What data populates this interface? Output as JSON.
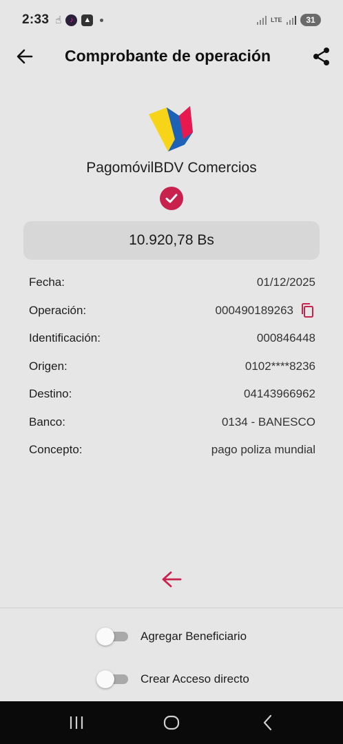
{
  "status_bar": {
    "time": "2:33",
    "network": "LTE",
    "battery": "31",
    "icons": [
      "hand-icon",
      "music-app-icon",
      "notification-icon",
      "dot-icon",
      "signal-icon",
      "lte-icon",
      "battery-icon"
    ]
  },
  "header": {
    "title": "Comprobante de operación",
    "back_icon": "arrow-left-icon",
    "share_icon": "share-icon"
  },
  "brand": {
    "name": "PagomóvilBDV Comercios",
    "logo_colors": [
      "#f7d418",
      "#e8194e",
      "#1e62b7"
    ]
  },
  "status": {
    "icon": "checkmark-circle-icon",
    "color": "#c8214e"
  },
  "amount": "10.920,78 Bs",
  "details": {
    "fecha": {
      "label": "Fecha:",
      "value": "01/12/2025"
    },
    "operacion": {
      "label": "Operación:",
      "value": "000490189263"
    },
    "identificacion": {
      "label": "Identificación:",
      "value": "000846448"
    },
    "origen": {
      "label": "Origen:",
      "value": "0102****8236"
    },
    "destino": {
      "label": "Destino:",
      "value": "04143966962"
    },
    "banco": {
      "label": "Banco:",
      "value": "0134 - BANESCO"
    },
    "concepto": {
      "label": "Concepto:",
      "value": "pago poliza mundial"
    }
  },
  "toggles": {
    "agregar": {
      "label": "Agregar Beneficiario",
      "on": false
    },
    "acceso": {
      "label": "Crear Acceso directo",
      "on": false
    }
  },
  "colors": {
    "accent": "#c8214e",
    "background": "#e6e6e6",
    "amount_box": "#d7d7d7"
  }
}
